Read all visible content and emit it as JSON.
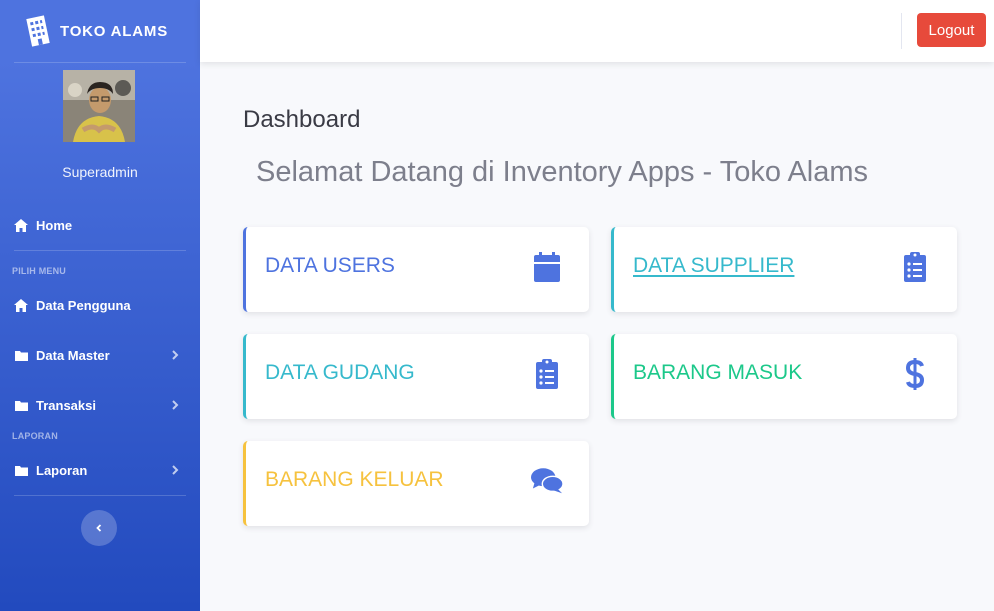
{
  "brand": {
    "name": "TOKO ALAMS"
  },
  "sidebar": {
    "username": "Superadmin",
    "home_label": "Home",
    "heading_menu": "PILIH MENU",
    "heading_report": "LAPORAN",
    "items": [
      {
        "label": "Data Pengguna",
        "icon": "home-icon"
      },
      {
        "label": "Data Master",
        "icon": "folder-icon"
      },
      {
        "label": "Transaksi",
        "icon": "folder-icon"
      },
      {
        "label": "Laporan",
        "icon": "folder-icon"
      }
    ]
  },
  "topbar": {
    "logout_label": "Logout"
  },
  "main": {
    "title": "Dashboard",
    "welcome": "Selamat Datang di Inventory Apps - Toko Alams",
    "cards": [
      {
        "label": "DATA USERS",
        "color": "#4e73df",
        "icon": "calendar-icon"
      },
      {
        "label": "DATA SUPPLIER",
        "color": "#36b9cc",
        "icon": "clipboard-list-icon"
      },
      {
        "label": "DATA GUDANG",
        "color": "#36b9cc",
        "icon": "clipboard-list-icon"
      },
      {
        "label": "BARANG MASUK",
        "color": "#1cc88a",
        "icon": "dollar-icon"
      },
      {
        "label": "BARANG KELUAR",
        "color": "#f6c23e",
        "icon": "comments-icon"
      }
    ]
  },
  "colors": {
    "primary": "#4e73df",
    "info": "#36b9cc",
    "success": "#1cc88a",
    "warning": "#f6c23e",
    "danger": "#e74a3b"
  }
}
